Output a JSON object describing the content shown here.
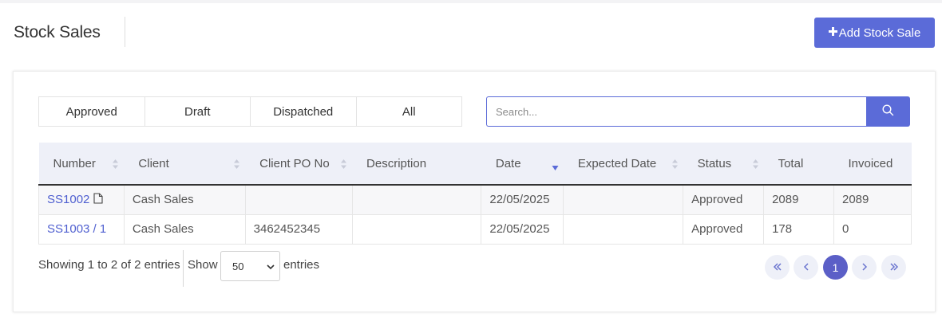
{
  "header": {
    "title": "Stock Sales",
    "add_button_label": "Add Stock Sale"
  },
  "filters": [
    "Approved",
    "Draft",
    "Dispatched",
    "All"
  ],
  "search": {
    "placeholder": "Search..."
  },
  "table": {
    "columns": [
      "Number",
      "Client",
      "Client PO No",
      "Description",
      "Date",
      "Expected Date",
      "Status",
      "Total",
      "Invoiced"
    ],
    "rows": [
      {
        "number": "SS1002",
        "client": "Cash Sales",
        "client_po": "",
        "description": "",
        "date": "22/05/2025",
        "expected_date": "",
        "status": "Approved",
        "total": "2089",
        "invoiced": "2089"
      },
      {
        "number": "SS1003 / 1",
        "client": "Cash Sales",
        "client_po": "3462452345",
        "description": "",
        "date": "22/05/2025",
        "expected_date": "",
        "status": "Approved",
        "total": "178",
        "invoiced": "0"
      }
    ]
  },
  "footer": {
    "info": "Showing 1 to 2 of 2 entries",
    "show_label": "Show",
    "page_size": "50",
    "entries_label": "entries",
    "current_page": "1"
  },
  "colors": {
    "accent": "#5b6bd8",
    "active_page": "#5b5fc7",
    "link": "#4f5fd0"
  },
  "icons": [
    "plus-icon",
    "search-icon",
    "sort-icon",
    "sort-desc-icon",
    "document-icon",
    "chevron-down-icon",
    "first-page-icon",
    "prev-page-icon",
    "next-page-icon",
    "last-page-icon"
  ]
}
